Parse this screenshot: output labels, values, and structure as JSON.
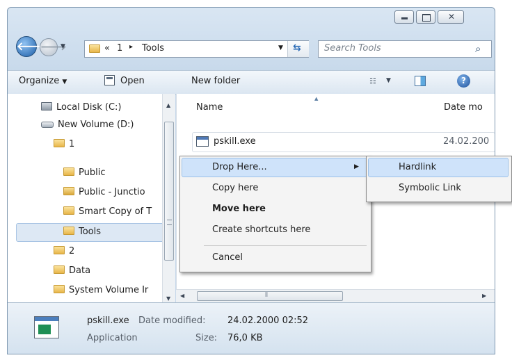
{
  "address": {
    "overflow": "«",
    "crumb1": "1",
    "sep": "▸",
    "crumb2": "Tools"
  },
  "search": {
    "placeholder": "Search Tools"
  },
  "toolbar": {
    "organize": "Organize",
    "open": "Open",
    "new_folder": "New folder"
  },
  "nav": {
    "items": [
      {
        "label": "Local Disk (C:)",
        "icon": "drive-c-icon"
      },
      {
        "label": "New Volume (D:)",
        "icon": "drive-icon"
      },
      {
        "label": "1",
        "icon": "folder-icon"
      },
      {
        "label": "Public",
        "icon": "folder-icon"
      },
      {
        "label": "Public - Junctio",
        "icon": "junction-folder-icon"
      },
      {
        "label": "Smart Copy of T",
        "icon": "folder-icon"
      },
      {
        "label": "Tools",
        "icon": "folder-icon",
        "selected": true
      },
      {
        "label": "2",
        "icon": "folder-icon"
      },
      {
        "label": "Data",
        "icon": "folder-icon"
      },
      {
        "label": "System Volume Ir",
        "icon": "folder-icon"
      }
    ]
  },
  "columns": {
    "name": "Name",
    "date": "Date mo"
  },
  "files": [
    {
      "name": "pskill.exe",
      "date": "24.02.200"
    }
  ],
  "context_menu": {
    "drop_here": "Drop Here...",
    "copy_here": "Copy here",
    "move_here": "Move here",
    "create_shortcuts": "Create shortcuts here",
    "cancel": "Cancel"
  },
  "submenu": {
    "hardlink": "Hardlink",
    "symbolic_link": "Symbolic Link"
  },
  "details": {
    "name": "pskill.exe",
    "type": "Application",
    "date_label": "Date modified:",
    "date_value": "24.02.2000 02:52",
    "size_label": "Size:",
    "size_value": "76,0 KB"
  },
  "colors": {
    "selection": "#dde8f4",
    "highlight": "#cfe3fa",
    "window_frame": "#c6d8ea"
  }
}
